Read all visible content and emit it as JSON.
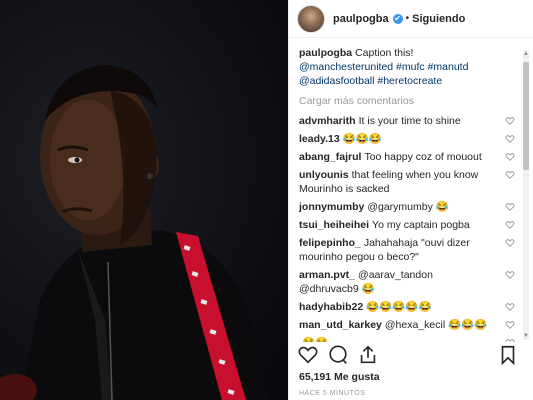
{
  "header": {
    "username": "paulpogba",
    "verified": "✔",
    "separator": "•",
    "follow_label": "Siguiendo"
  },
  "caption": {
    "username": "paulpogba",
    "text": "Caption this!",
    "line2": "@manchesterunited #mufc #manutd",
    "line3": "@adidasfootball #heretocreate"
  },
  "load_more": "Cargar más comentarios",
  "comments": [
    {
      "user": "advmharith",
      "text": "It is your time to shine"
    },
    {
      "user": "leady.13",
      "text": "😂😂😂"
    },
    {
      "user": "abang_fajrul",
      "text": "Too happy coz of mouout"
    },
    {
      "user": "unlyounis",
      "text": "that feeling when you know Mourinho is sacked"
    },
    {
      "user": "jonnymumby",
      "text": "@garymumby 😂"
    },
    {
      "user": "tsui_heiheihei",
      "text": "Yo my captain pogba"
    },
    {
      "user": "felipepinho_",
      "text": "Jahahahaja \"ouvi dizer mourinho pegou o beco?\""
    },
    {
      "user": "arman.pvt_",
      "text": "@aarav_tandon @dhruvacb9 😂"
    },
    {
      "user": "hadyhabib22",
      "text": "😂😂😂😂😂"
    },
    {
      "user": "man_utd_karkey",
      "text": "@hexa_kecil 😂😂😂"
    },
    {
      "user": "",
      "text": "😂😂"
    }
  ],
  "likes": "65,191 Me gusta",
  "time": "HACE 5 MINUTOS",
  "colors": {
    "link": "#003569",
    "verified": "#3897f0",
    "jacket_stripe": "#c8102e"
  }
}
